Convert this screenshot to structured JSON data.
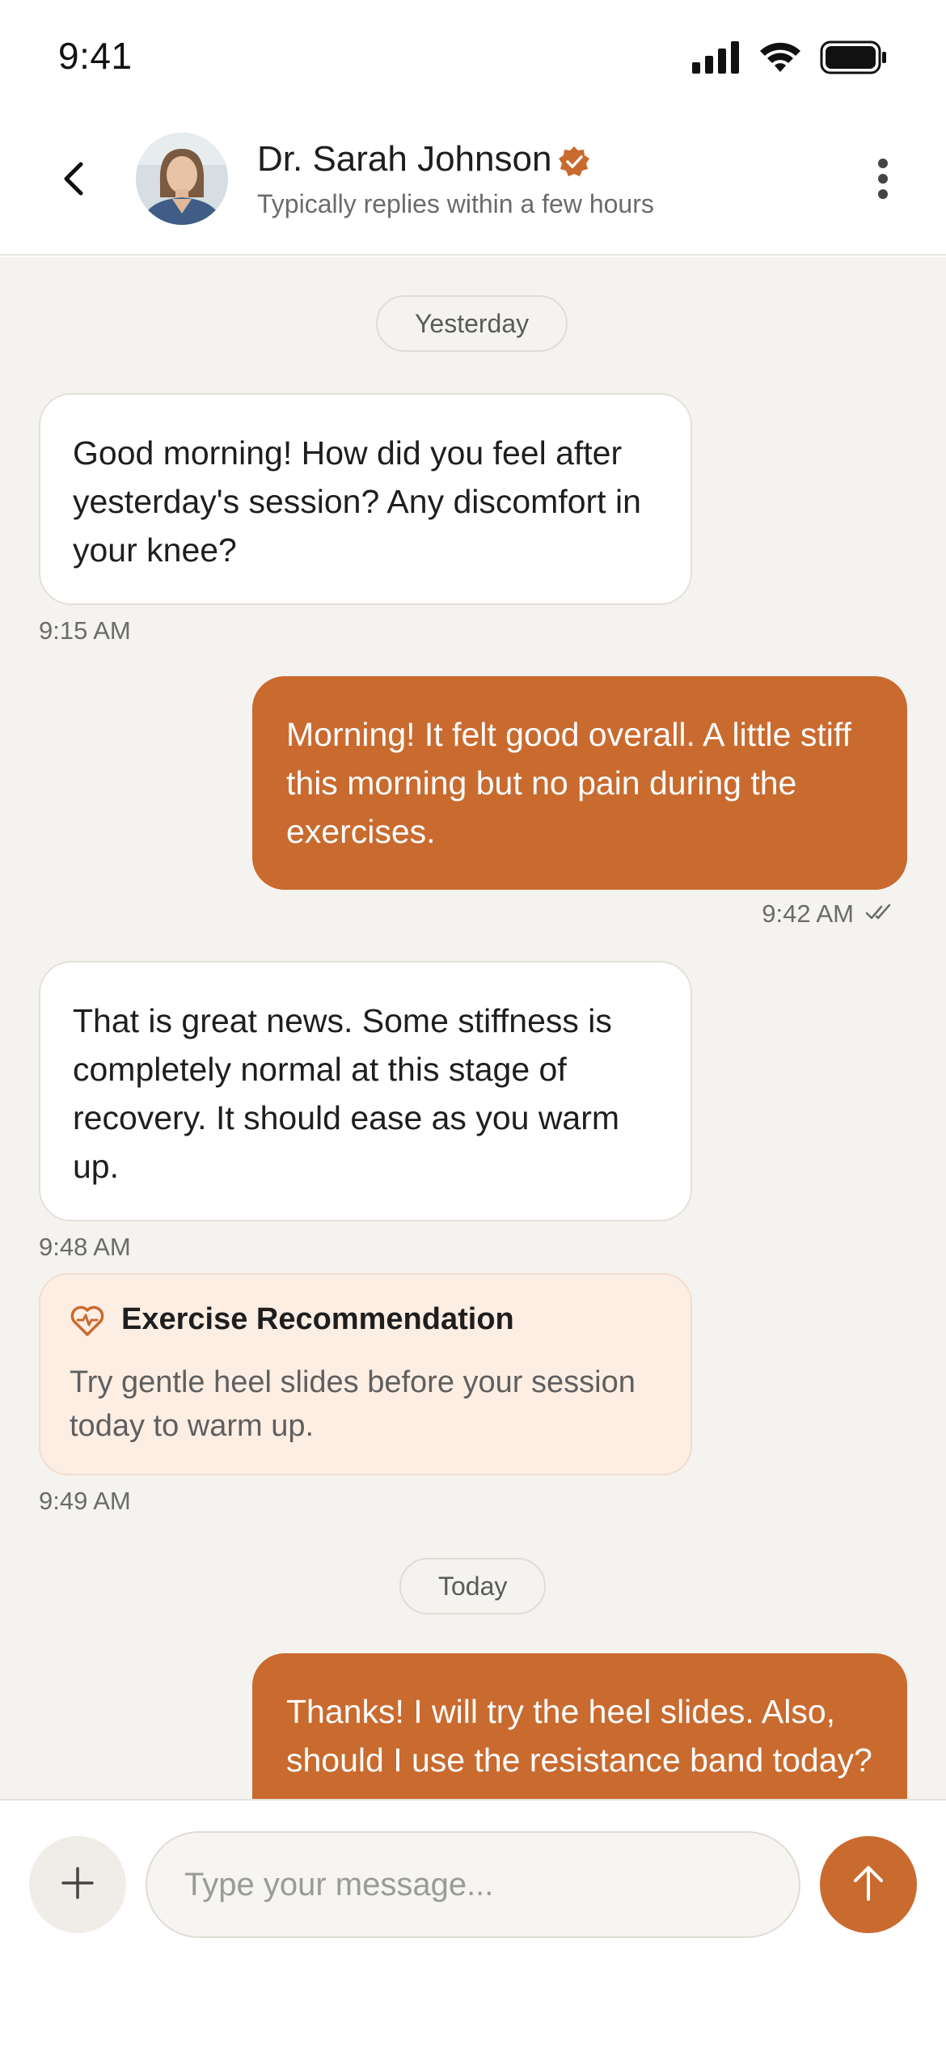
{
  "status_bar": {
    "time": "9:41",
    "icons": [
      "signal-icon",
      "wifi-icon",
      "battery-icon"
    ]
  },
  "header": {
    "contact_name": "Dr. Sarah Johnson",
    "contact_status": "Typically replies within a few hours",
    "verified": true,
    "icons": {
      "back": "chevron-left-icon",
      "more": "more-vertical-icon",
      "verified": "verified-badge-icon"
    }
  },
  "conversation": {
    "date_yesterday": "Yesterday",
    "date_today": "Today",
    "messages": [
      {
        "direction": "incoming",
        "text": "Good morning! How did you feel after yesterday's session? Any discomfort in your knee?",
        "time": "9:15 AM"
      },
      {
        "direction": "outgoing",
        "text": "Morning! It felt good overall. A little stiff this morning but no pain during the exercises.",
        "time": "9:42 AM",
        "status": "read"
      },
      {
        "direction": "incoming",
        "text": "That is great news. Some stiffness is completely normal at this stage of recovery. It should ease as you warm up.",
        "time": "9:48 AM"
      },
      {
        "direction": "outgoing",
        "text": "Thanks! I will try the heel slides. Also, should I use the resistance band today?",
        "time": ""
      }
    ],
    "recommendation": {
      "title": "Exercise Recommendation",
      "body": "Try gentle heel slides before your session today to warm up.",
      "time": "9:49 AM",
      "icon": "heart-icon"
    }
  },
  "composer": {
    "placeholder": "Type your message...",
    "value": "",
    "icons": {
      "add": "plus-icon",
      "send": "arrow-up-icon"
    }
  },
  "colors": {
    "accent": "#c96a2f",
    "background": "#f5f3ef",
    "card_background": "#fdeee4",
    "incoming_bubble": "#ffffff"
  }
}
